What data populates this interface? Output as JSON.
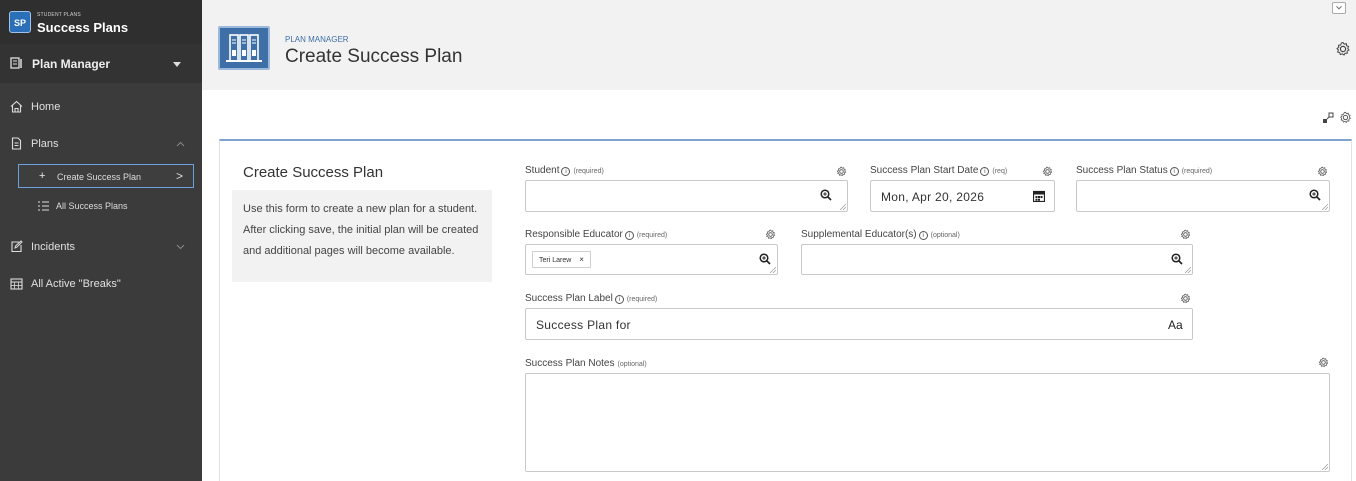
{
  "sidebar": {
    "logo": "SP",
    "app_subtitle": "STUDENT PLANS",
    "app_title": "Success Plans",
    "section_label": "Plan Manager",
    "items": [
      {
        "label": "Home",
        "icon": "home-icon"
      },
      {
        "label": "Plans",
        "icon": "document-icon"
      },
      {
        "label": "Incidents",
        "icon": "edit-icon"
      },
      {
        "label": "All Active \"Breaks\"",
        "icon": "calendar-icon"
      }
    ],
    "subitems": [
      {
        "label": "Create Success Plan",
        "icon": "plus-icon",
        "active": true
      },
      {
        "label": "All Success Plans",
        "icon": "list-icon",
        "active": false
      }
    ]
  },
  "header": {
    "subtitle": "PLAN MANAGER",
    "title": "Create Success Plan",
    "icon": "books-icon"
  },
  "info": {
    "title": "Create Success Plan",
    "text": "Use this form to create a new plan for a student. After clicking save, the initial plan will be created and additional pages will become available."
  },
  "form": {
    "student": {
      "label": "Student",
      "req": "(required)",
      "value": ""
    },
    "start_date": {
      "label": "Success Plan Start Date",
      "req": "(req)",
      "value": "Mon, Apr 20, 2026"
    },
    "status": {
      "label": "Success Plan Status",
      "req": "(required)",
      "value": ""
    },
    "educator": {
      "label": "Responsible Educator",
      "req": "(required)",
      "chip": "Teri Larew",
      "chip_remove": "×"
    },
    "supplemental": {
      "label": "Supplemental Educator(s)",
      "req": "(optional)",
      "value": ""
    },
    "plan_label": {
      "label": "Success Plan Label",
      "req": "(required)",
      "value": "Success Plan for",
      "font_button": "Aa"
    },
    "notes": {
      "label": "Success Plan Notes",
      "req": "(optional)",
      "value": ""
    }
  },
  "colors": {
    "sidebar_bg": "#3b3b3b",
    "accent": "#3e6fa6",
    "header_bg": "#f2f2f2"
  }
}
